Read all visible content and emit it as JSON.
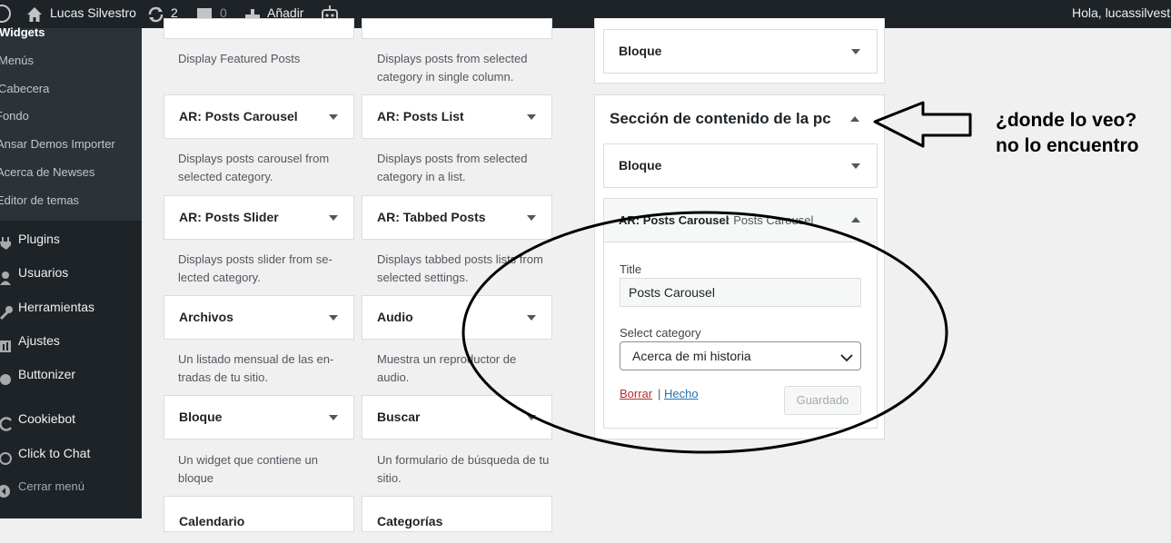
{
  "admin_bar": {
    "site_name": "Lucas Silvestro",
    "updates_count": "2",
    "comments_count": "0",
    "new_label": "Añadir",
    "greeting": "Hola, lucassilvestro"
  },
  "sidebar": {
    "submenu": [
      "Widgets",
      "Menús",
      "Cabecera",
      "Fondo",
      "Ansar Demos Importer",
      "Acerca de Newses",
      "Editor de temas"
    ],
    "menu": [
      "Plugins",
      "Usuarios",
      "Herramientas",
      "Ajustes",
      "Buttonizer",
      "Cookiebot",
      "Click to Chat"
    ],
    "collapse_label": "Cerrar menú"
  },
  "available_widgets": {
    "top_desc_left": "Display Featured Posts",
    "top_desc_right": "Displays posts from selected category in single column.",
    "items": [
      {
        "title": "AR: Posts Carousel",
        "desc": "Displays posts carousel from selected category."
      },
      {
        "title": "AR: Posts List",
        "desc": "Displays posts from selected category in a list."
      },
      {
        "title": "AR: Posts Slider",
        "desc": "Displays posts slider from se­lected category."
      },
      {
        "title": "AR: Tabbed Posts",
        "desc": "Displays tabbed posts lists from selected settings."
      },
      {
        "title": "Archivos",
        "desc": "Un listado mensual de las en­tradas de tu sitio."
      },
      {
        "title": "Audio",
        "desc": "Muestra un reproductor de audio."
      },
      {
        "title": "Bloque",
        "desc": "Un widget que contiene un bloque"
      },
      {
        "title": "Buscar",
        "desc": "Un formulario de búsqueda de tu sitio."
      },
      {
        "title": "Calendario",
        "desc": ""
      },
      {
        "title": "Categorías",
        "desc": ""
      }
    ]
  },
  "widget_area": {
    "top_widget": "Bloque",
    "title": "Sección de contenido de la pc",
    "block_widget": "Bloque",
    "open_widget_title": "AR: Posts Carousel",
    "open_widget_subtitle": ": Posts Carousel",
    "title_label": "Title",
    "title_value": "Posts Carousel",
    "category_label": "Select category",
    "category_value": "Acerca de mi historia",
    "delete_label": "Borrar",
    "separator": "|",
    "done_label": "Hecho",
    "saved_label": "Guardado"
  },
  "annotation": {
    "line1": "¿donde lo veo?",
    "line2": "no lo encuentro"
  },
  "colors": {
    "admin_bar": "#1d2327",
    "submenu": "#2c3338",
    "delete_link": "#b32d2e",
    "done_link": "#2271b1"
  }
}
